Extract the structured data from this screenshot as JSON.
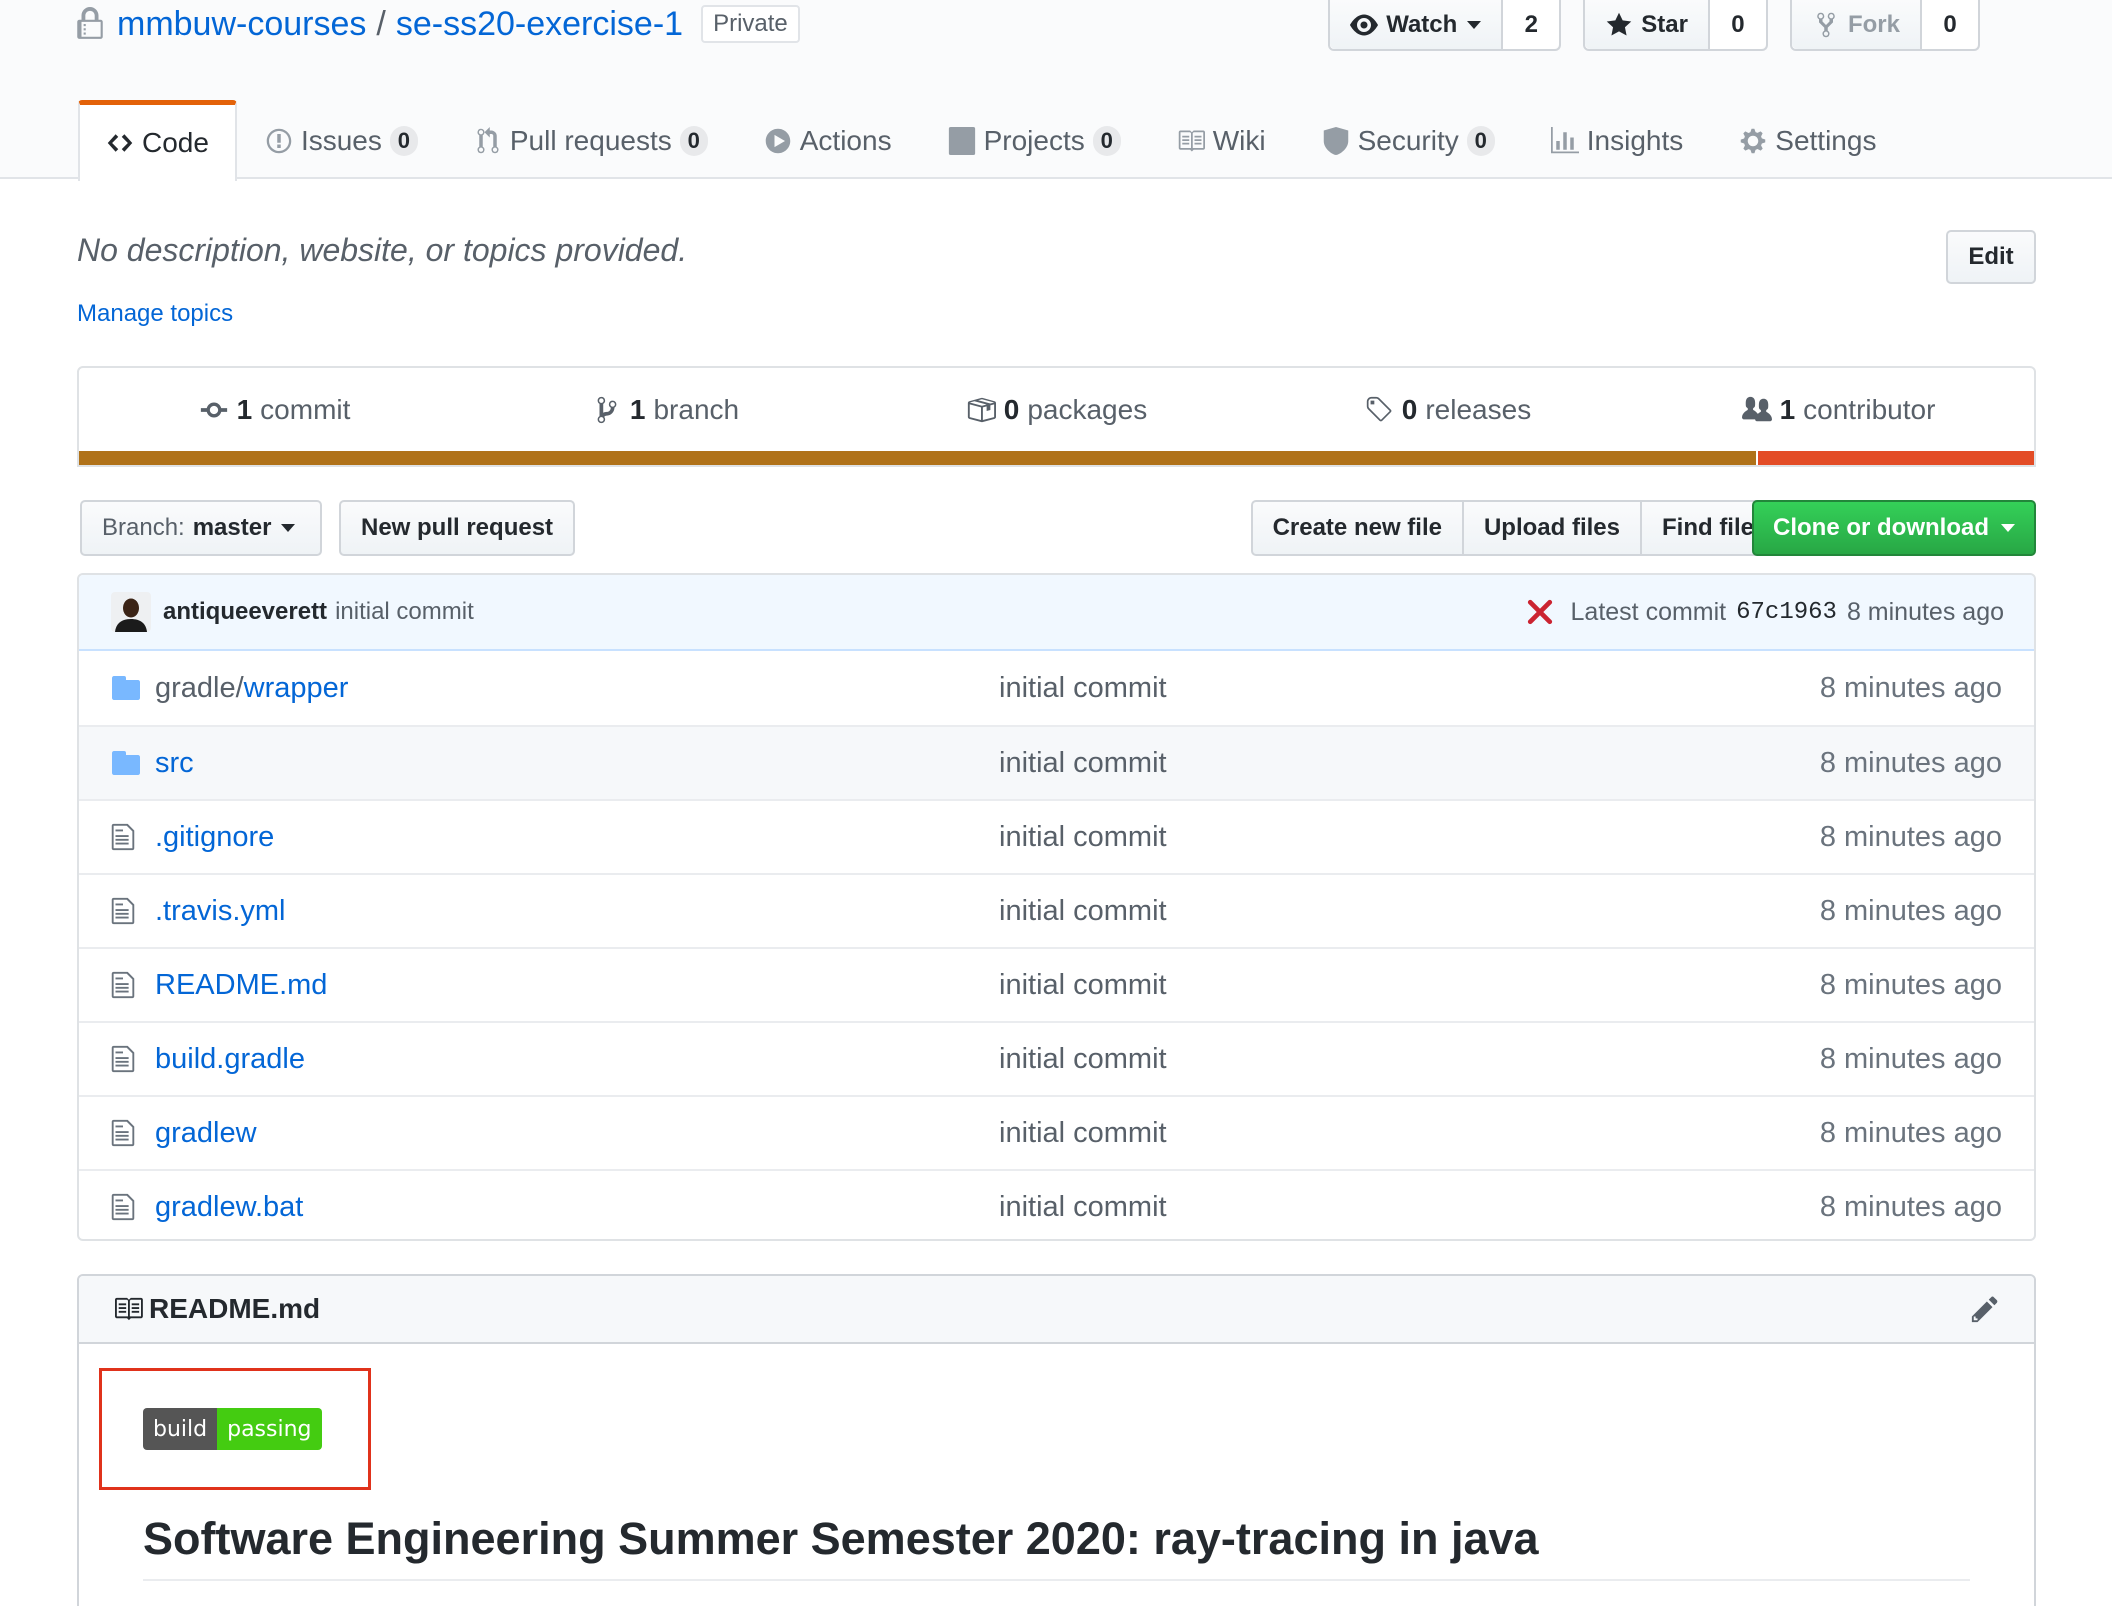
{
  "repo": {
    "owner": "mmbuw-courses",
    "separator": "/",
    "name": "se-ss20-exercise-1",
    "visibility": "Private"
  },
  "actions": {
    "watch": {
      "label": "Watch",
      "count": "2"
    },
    "star": {
      "label": "Star",
      "count": "0"
    },
    "fork": {
      "label": "Fork",
      "count": "0"
    }
  },
  "tabs": [
    {
      "label": "Code",
      "icon": "code-icon"
    },
    {
      "label": "Issues",
      "count": "0",
      "icon": "issue-icon"
    },
    {
      "label": "Pull requests",
      "count": "0",
      "icon": "pull-request-icon"
    },
    {
      "label": "Actions",
      "icon": "play-icon"
    },
    {
      "label": "Projects",
      "count": "0",
      "icon": "project-icon"
    },
    {
      "label": "Wiki",
      "icon": "book-icon"
    },
    {
      "label": "Security",
      "count": "0",
      "icon": "shield-icon"
    },
    {
      "label": "Insights",
      "icon": "graph-icon"
    },
    {
      "label": "Settings",
      "icon": "gear-icon"
    }
  ],
  "about": {
    "description": "No description, website, or topics provided.",
    "edit_label": "Edit",
    "manage_topics": "Manage topics"
  },
  "summary": {
    "commits": {
      "num": "1",
      "label": "commit"
    },
    "branches": {
      "num": "1",
      "label": "branch"
    },
    "packages": {
      "num": "0",
      "label": "packages"
    },
    "releases": {
      "num": "0",
      "label": "releases"
    },
    "contributors": {
      "num": "1",
      "label": "contributor"
    },
    "languages": [
      {
        "share": 0.858,
        "color": "#b07219"
      },
      {
        "share": 0.142,
        "color": "#e34c26"
      }
    ]
  },
  "file_nav": {
    "branch_prefix": "Branch:",
    "branch": "master",
    "new_pull_request": "New pull request",
    "create_new_file": "Create new file",
    "upload_files": "Upload files",
    "find_file": "Find file",
    "clone_or_download": "Clone or download"
  },
  "commit": {
    "author": "antiqueeverett",
    "message": "initial commit",
    "status": "failure",
    "latest_label": "Latest commit",
    "sha": "67c1963",
    "age": "8 minutes ago"
  },
  "files": [
    {
      "prefix": "gradle/",
      "name": "wrapper",
      "type": "dir",
      "message": "initial commit",
      "age": "8 minutes ago"
    },
    {
      "prefix": "",
      "name": "src",
      "type": "dir",
      "message": "initial commit",
      "age": "8 minutes ago"
    },
    {
      "prefix": "",
      "name": ".gitignore",
      "type": "file",
      "message": "initial commit",
      "age": "8 minutes ago"
    },
    {
      "prefix": "",
      "name": ".travis.yml",
      "type": "file",
      "message": "initial commit",
      "age": "8 minutes ago"
    },
    {
      "prefix": "",
      "name": "README.md",
      "type": "file",
      "message": "initial commit",
      "age": "8 minutes ago"
    },
    {
      "prefix": "",
      "name": "build.gradle",
      "type": "file",
      "message": "initial commit",
      "age": "8 minutes ago"
    },
    {
      "prefix": "",
      "name": "gradlew",
      "type": "file",
      "message": "initial commit",
      "age": "8 minutes ago"
    },
    {
      "prefix": "",
      "name": "gradlew.bat",
      "type": "file",
      "message": "initial commit",
      "age": "8 minutes ago"
    }
  ],
  "readme": {
    "filename": "README.md",
    "badge": {
      "left": "build",
      "right": "passing"
    },
    "title": "Software Engineering Summer Semester 2020: ray-tracing in java"
  },
  "colors": {
    "link": "#0366d6",
    "selected_tab": "#e36209",
    "clone_button": "#28a745",
    "commit_failure": "#cb2431",
    "annotation_box": "#e0321b"
  }
}
